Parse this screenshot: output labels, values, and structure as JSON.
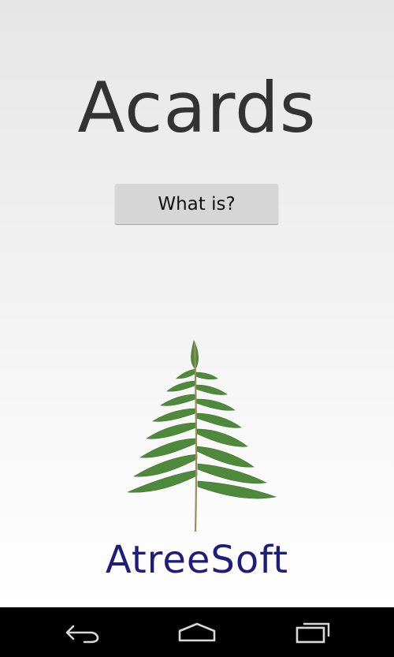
{
  "app": {
    "title": "Acards",
    "brand": "AtreeSoft",
    "logo_icon": "fern-leaf-icon"
  },
  "main": {
    "what_is_label": "What is?"
  },
  "navbar": {
    "back_icon": "back-arrow-icon",
    "home_icon": "home-icon",
    "recent_icon": "recent-apps-icon"
  },
  "colors": {
    "title": "#333333",
    "brand": "#1e1e7a",
    "button_bg": "#d6d6d6",
    "fern": "#4f8a3c",
    "navbar": "#000000"
  }
}
